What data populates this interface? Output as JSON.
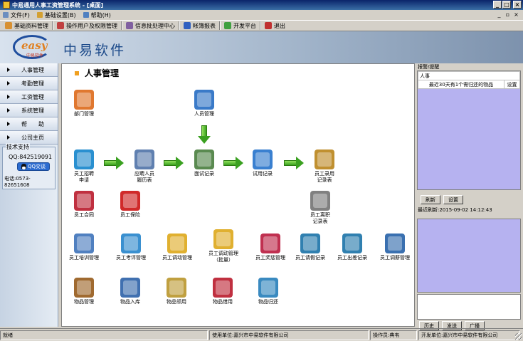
{
  "window": {
    "title": "中易通用人事工资管理系统 - [桌面]"
  },
  "menu": [
    {
      "label": "文件(F)",
      "color": "#6c8ebf"
    },
    {
      "label": "基础设置(B)",
      "color": "#d4a030"
    },
    {
      "label": "帮助(H)",
      "color": "#5080c0"
    }
  ],
  "toolbar": [
    {
      "label": "基础资料管理",
      "icon": "folder-icon",
      "color": "#d89030"
    },
    {
      "label": "操作用户及权限管理",
      "icon": "user-key-icon",
      "color": "#c04040"
    },
    {
      "label": "信息批处理中心",
      "icon": "batch-icon",
      "color": "#8060a0"
    },
    {
      "label": "帐簿报表",
      "icon": "book-icon",
      "color": "#3060c0"
    },
    {
      "label": "开发平台",
      "icon": "leaf-icon",
      "color": "#40a040"
    },
    {
      "label": "退出",
      "icon": "exit-icon",
      "color": "#c03030"
    }
  ],
  "banner": {
    "logo": "easy",
    "logo_sub": "中易软件",
    "company": "中易软件"
  },
  "nav": [
    {
      "label": "人事管理"
    },
    {
      "label": "考勤管理"
    },
    {
      "label": "工资管理"
    },
    {
      "label": "系统管理"
    },
    {
      "label": "帮　　助"
    },
    {
      "label": "公司主页"
    }
  ],
  "support": {
    "legend": "技术支持",
    "qq": "QQ:842519091",
    "qq_button": "QQ交谈",
    "phone": "电话:0573-82651608"
  },
  "main": {
    "title": "人事管理",
    "items": [
      {
        "id": "dept",
        "label": "部门管理",
        "color": "#e07830",
        "icon": "department-icon"
      },
      {
        "id": "staff",
        "label": "人员管理",
        "color": "#3a7ac8",
        "icon": "personnel-icon"
      },
      {
        "id": "recruit",
        "label": "员工招聘\n申请",
        "color": "#2a90d0",
        "icon": "recruit-icon"
      },
      {
        "id": "resume",
        "label": "应聘人员\n履历表",
        "color": "#6080b0",
        "icon": "resume-icon"
      },
      {
        "id": "interview",
        "label": "面试记录",
        "color": "#5a8a50",
        "icon": "interview-icon"
      },
      {
        "id": "trial",
        "label": "试用记录",
        "color": "#3a80d0",
        "icon": "trial-icon"
      },
      {
        "id": "hire",
        "label": "员工录用\n记录表",
        "color": "#c09030",
        "icon": "hire-icon"
      },
      {
        "id": "contract",
        "label": "员工合同",
        "color": "#c03040",
        "icon": "contract-icon"
      },
      {
        "id": "insurance",
        "label": "员工保险",
        "color": "#d02a2a",
        "icon": "insurance-icon"
      },
      {
        "id": "leave",
        "label": "员工离职\n记录表",
        "color": "#808080",
        "icon": "resign-icon"
      },
      {
        "id": "training",
        "label": "员工培训管理",
        "color": "#5080c0",
        "icon": "training-icon"
      },
      {
        "id": "appraisal",
        "label": "员工考评管理",
        "color": "#3a90d0",
        "icon": "appraisal-icon"
      },
      {
        "id": "transfer",
        "label": "员工调动管理",
        "color": "#e0b030",
        "icon": "transfer-icon"
      },
      {
        "id": "batch_transfer",
        "label": "员工调动管理\n（批量）",
        "color": "#e0b030",
        "icon": "batch-transfer-icon"
      },
      {
        "id": "reward",
        "label": "员工奖惩管理",
        "color": "#c03050",
        "icon": "reward-icon"
      },
      {
        "id": "leave_req",
        "label": "员工请假记录",
        "color": "#3080b0",
        "icon": "leave-request-icon"
      },
      {
        "id": "trip",
        "label": "员工出差记录",
        "color": "#3080b0",
        "icon": "business-trip-icon"
      },
      {
        "id": "salary_adj",
        "label": "员工调薪管理",
        "color": "#3a70b0",
        "icon": "salary-adjust-icon"
      },
      {
        "id": "goods",
        "label": "物品管理",
        "color": "#a06a30",
        "icon": "goods-icon"
      },
      {
        "id": "goods_in",
        "label": "物品入库",
        "color": "#4070b0",
        "icon": "goods-in-icon"
      },
      {
        "id": "goods_use",
        "label": "物品领用",
        "color": "#c0a040",
        "icon": "goods-use-icon"
      },
      {
        "id": "goods_borrow",
        "label": "物品借用",
        "color": "#c03040",
        "icon": "goods-borrow-icon"
      },
      {
        "id": "goods_return",
        "label": "物品归还",
        "color": "#3a8ac0",
        "icon": "goods-return-icon"
      }
    ]
  },
  "right": {
    "alert_title": "报警/提醒",
    "alert_head": "人事",
    "alert_text": "最近30天有1个需归还的物品",
    "alert_action": "设置",
    "refresh_button": "刷新",
    "settings_button": "设置",
    "last_refresh": "最近刷新:2015-09-02 14:12:43",
    "history_button": "历史",
    "send_button": "发送",
    "broadcast_button": "广播"
  },
  "status": {
    "state": "就绪",
    "user_unit": "使用单位:嘉兴市中易软件有限公司",
    "operator": "操作员:典韦",
    "developer": "开发单位:嘉兴市中易软件有限公司"
  }
}
